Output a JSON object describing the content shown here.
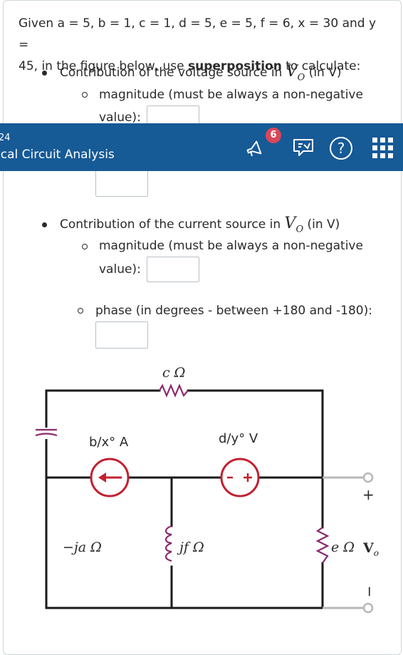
{
  "problem": {
    "intro_prefix": "Given a = 5, b = 1, c = 1, d = 5, e = 5, f = 6, x = 30 and y =",
    "intro_line2_prefix": "45, in the figure below, use ",
    "intro_bold": "superposition",
    "intro_line2_suffix": " to calculate:"
  },
  "voltage_section": {
    "label_prefix": "Contribution of the voltage source in ",
    "label_suffix": "(in V)",
    "magnitude_line1": "magnitude (must be always a non-negative",
    "magnitude_line2": "value):"
  },
  "current_section": {
    "label_prefix": "Contribution of the current source in ",
    "label_suffix": "(in V)",
    "magnitude_line1": "magnitude (must be always a non-negative",
    "magnitude_line2": "value):",
    "phase_label": "phase (in degrees - between +180 and -180):"
  },
  "vo_symbol": "V",
  "vo_subscript": "O",
  "header": {
    "number": "24",
    "title": "ical Circuit Analysis",
    "notification_count": "6"
  },
  "circuit": {
    "resistor_c": "c Ω",
    "current_source": "b/x° A",
    "voltage_source": "d/y° V",
    "capacitor": "−ja Ω",
    "inductor": "jf Ω",
    "resistor_e": "e Ω",
    "vo_label": "V",
    "vo_sub": "o",
    "plus": "+",
    "minus": "−"
  }
}
